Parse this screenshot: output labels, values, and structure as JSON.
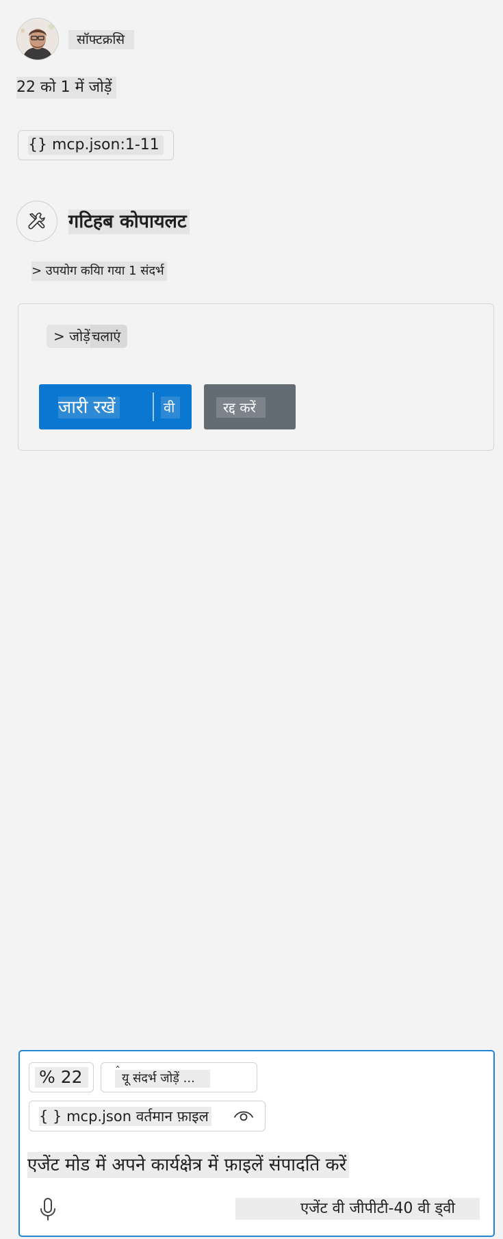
{
  "user_message": {
    "username": "सॉफ्टक्रसि",
    "text": "22 को 1 में जोड़ें",
    "reference_chip": "{} mcp.json:1-11"
  },
  "response": {
    "agent_name": "गटिहब कोपायलट",
    "references_used": "> उपयोग कयिा गया 1 संदर्भ",
    "tool_card": {
      "run_label_main": "> जोड़ें ",
      "run_label_tail": "चलाएं",
      "continue_label": "जारी रखें",
      "continue_dropdown": "वी",
      "cancel_label": "रद्द करें"
    }
  },
  "chat_input": {
    "chip_percent": "% 22",
    "chip_add_context": "यू संदर्भ जोड़ें ...",
    "chip_add_context_caret": "ˆ",
    "chip_file": "{ } mcp.json वर्तमान फ़ाइल",
    "prompt_text": "एजेंट मोड में अपने कार्यक्षेत्र में फ़ाइलें संपादति करें",
    "model_picker": "एजेंट वी जीपीटी-40 वी ड्वी"
  },
  "icons": {
    "user_avatar": "avatar-photo",
    "agent_avatar": "tools-icon",
    "file_chip": "eye-icon",
    "voice": "microphone-icon"
  },
  "colors": {
    "background": "#f3f3f3",
    "primary_button": "#0a78d0",
    "secondary_button": "#636b75",
    "input_focus_border": "#1f86d6"
  }
}
